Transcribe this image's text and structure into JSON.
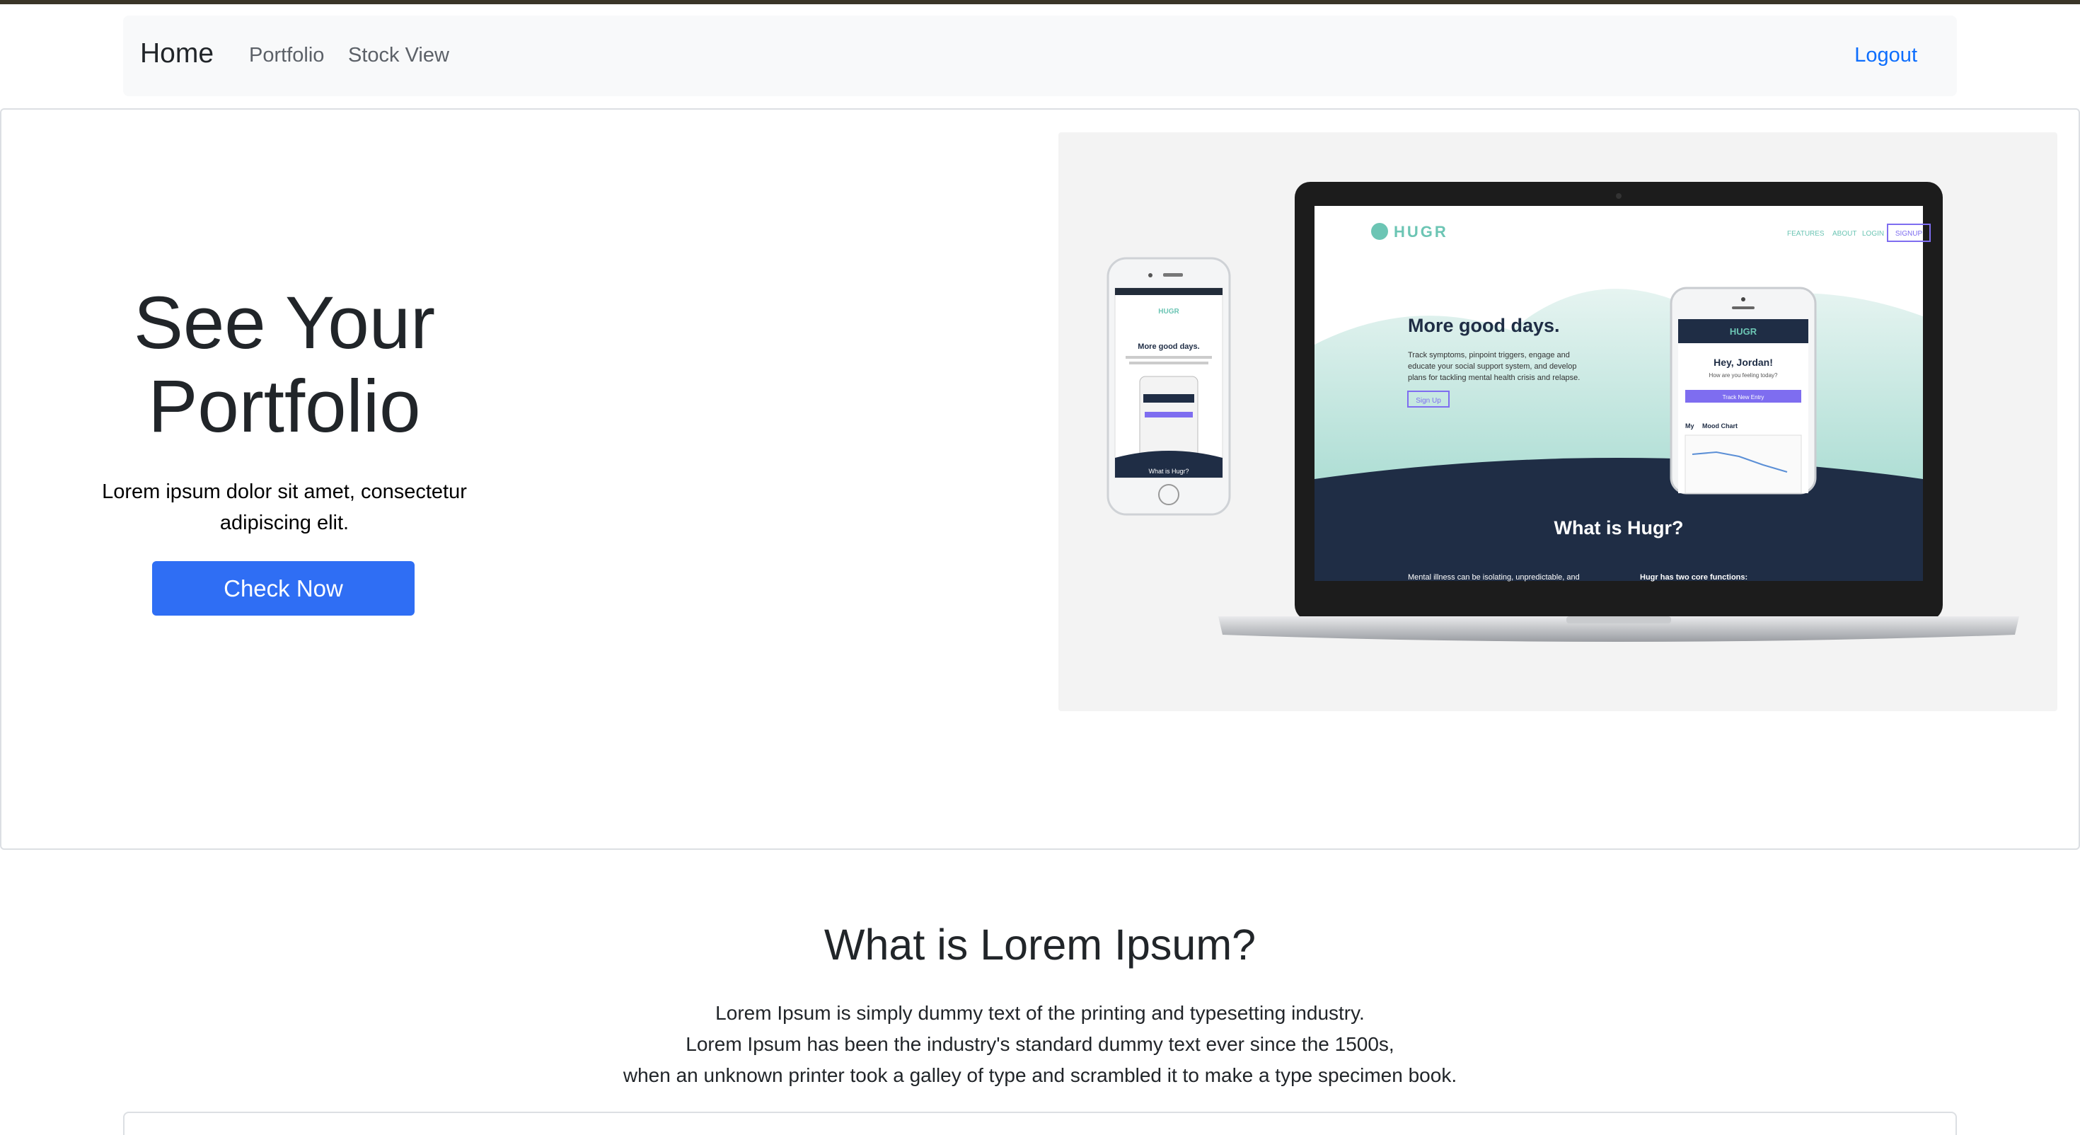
{
  "navbar": {
    "brand": "Home",
    "links": [
      "Portfolio",
      "Stock View"
    ],
    "logout": "Logout"
  },
  "hero": {
    "title": "See Your Portfolio",
    "lead": "Lorem ipsum dolor sit amet, consectetur adipiscing elit.",
    "button": "Check Now",
    "mockup": {
      "logo": "HUGR",
      "nav": [
        "FEATURES",
        "ABOUT",
        "LOGIN",
        "SIGNUP"
      ],
      "headline": "More good days.",
      "body": [
        "Track symptoms, pinpoint triggers, engage and",
        "educate your social support system, and develop",
        "plans for tackling mental health crisis and relapse."
      ],
      "signup_btn": "Sign Up",
      "what_is": "What is Hugr?",
      "footer_left": "Mental illness can be isolating, unpredictable, and",
      "footer_right": "Hugr has two core functions:",
      "phone_greeting": "Hey, Jordan!",
      "phone_sub": "How are you feeling today?",
      "phone_btn": "Track New Entry",
      "phone_chart": "Mood Chart",
      "phone_my": "My",
      "small_phone_headline": "More good days.",
      "small_phone_footer": "What is Hugr?"
    }
  },
  "section": {
    "title": "What is Lorem Ipsum?",
    "lines": [
      "Lorem Ipsum is simply dummy text of the printing and typesetting industry.",
      "Lorem Ipsum has been the industry's standard dummy text ever since the 1500s,",
      "when an unknown printer took a galley of type and scrambled it to make a type specimen book."
    ]
  }
}
